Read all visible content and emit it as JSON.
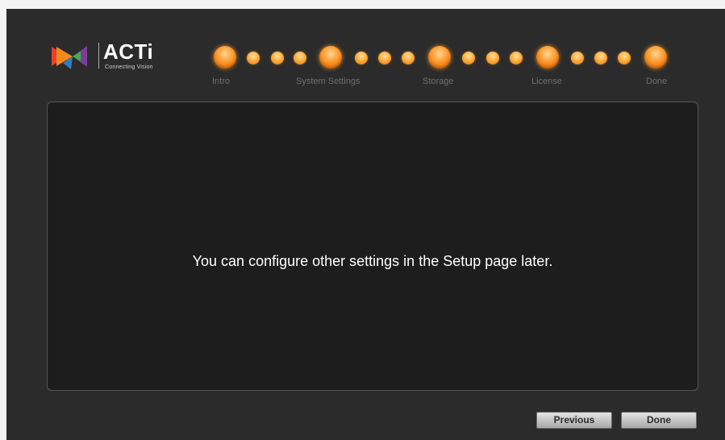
{
  "logo": {
    "brand": "ACTi",
    "tagline": "Connecting Vision"
  },
  "steps": [
    {
      "label": "Intro"
    },
    {
      "label": "System Settings"
    },
    {
      "label": "Storage"
    },
    {
      "label": "License"
    },
    {
      "label": "Done"
    }
  ],
  "progress": {
    "sub_steps_between_major": 3
  },
  "main": {
    "message": "You can configure other settings in the Setup page later."
  },
  "footer": {
    "previous_label": "Previous",
    "done_label": "Done"
  },
  "colors": {
    "accent": "#f58a1c",
    "background": "#2b2b2b",
    "panel": "#1d1d1d"
  }
}
